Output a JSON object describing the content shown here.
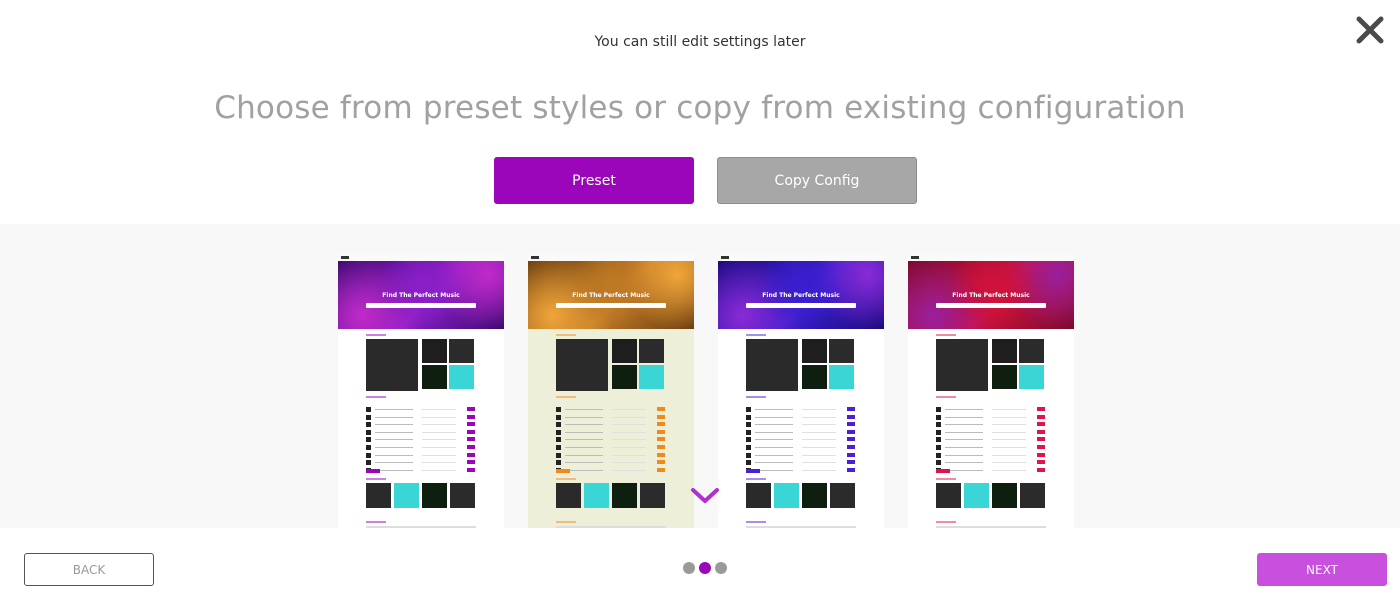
{
  "header": {
    "subtitle": "You can still edit settings later",
    "title": "Choose from preset styles or copy from existing configuration"
  },
  "tabs": [
    {
      "label": "Preset",
      "active": true
    },
    {
      "label": "Copy Config",
      "active": false
    }
  ],
  "presets": [
    {
      "hero_text": "Find The Perfect Music",
      "theme": "purple",
      "accent": "#9b06bb",
      "page_bg": "#ffffff",
      "hero_colors": [
        "#3a0a6e",
        "#8b1fc9",
        "#c12ac9"
      ]
    },
    {
      "hero_text": "Find The Perfect Music",
      "theme": "orange",
      "accent": "#f08a1d",
      "page_bg": "#eeefd8",
      "hero_colors": [
        "#6b3e10",
        "#c07a25",
        "#f0a53a"
      ]
    },
    {
      "hero_text": "Find The Perfect Music",
      "theme": "blue",
      "accent": "#4b1fd8",
      "page_bg": "#ffffff",
      "hero_colors": [
        "#1a0a7a",
        "#3b1fd0",
        "#8a2ad6"
      ]
    },
    {
      "hero_text": "Find The Perfect Music",
      "theme": "red",
      "accent": "#e0134b",
      "page_bg": "#ffffff",
      "hero_colors": [
        "#7a0a2a",
        "#d0123c",
        "#9a1f9e"
      ]
    }
  ],
  "icons": {
    "close": "close-icon",
    "scroll": "chevron-down-icon"
  },
  "footer": {
    "back_label": "BACK",
    "next_label": "NEXT",
    "steps": 3,
    "current_step": 2
  },
  "colors": {
    "primary": "#9b06bb",
    "next": "#c94fde",
    "inactive_tab": "#a7a7a7"
  }
}
